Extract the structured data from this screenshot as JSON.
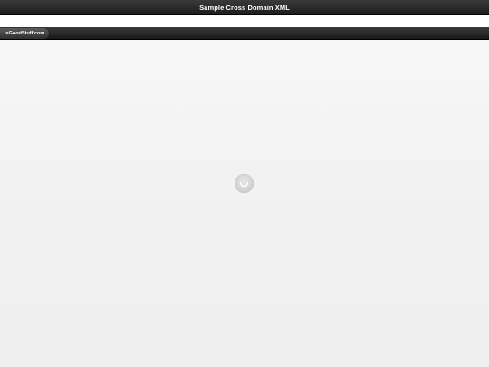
{
  "header": {
    "title": "Sample Cross Domain XML"
  },
  "subbar": {
    "tab_label": "isGoodStuff.com"
  },
  "content": {
    "loading_icon": "loading-spinner-icon"
  },
  "colors": {
    "bar_dark": "#1c1c1c",
    "bar_light": "#3a3a3a",
    "content_background": "#f2f2f2",
    "title_text": "#ffffff"
  }
}
